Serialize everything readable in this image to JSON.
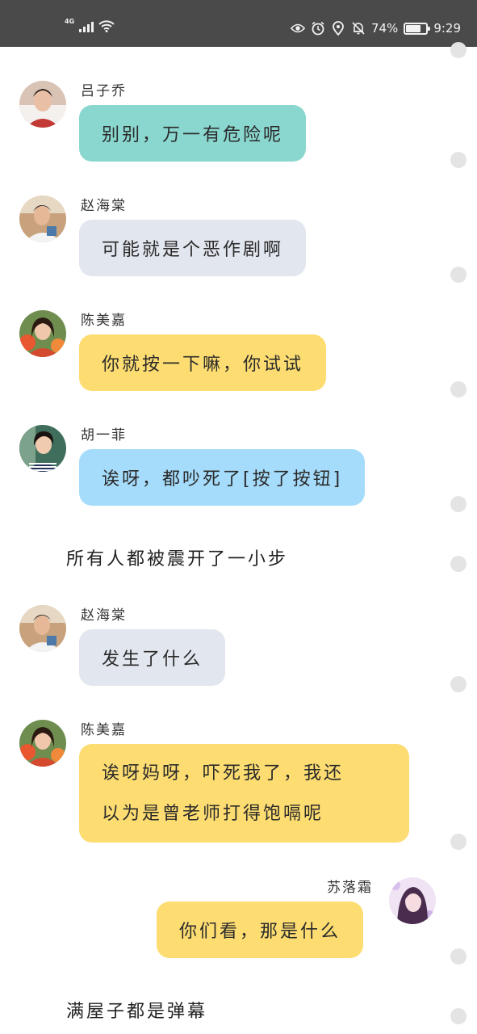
{
  "status_bar": {
    "network": "4G",
    "battery": "74%",
    "battery_level": 0.74,
    "time": "9:29",
    "icons": [
      "signal-icon",
      "wifi-icon",
      "eye-icon",
      "alarm-icon",
      "location-icon",
      "mute-bell-icon",
      "battery-icon"
    ]
  },
  "colors": {
    "teal": "#8ad7cf",
    "gray": "#e2e6ee",
    "yellow": "#fddd72",
    "blue": "#a6dcfb"
  },
  "messages": [
    {
      "type": "chat",
      "side": "left",
      "name": "吕子乔",
      "avatar": "avatar-lv",
      "color": "#8ad7cf",
      "text": "别别，万一有危险呢"
    },
    {
      "type": "chat",
      "side": "left",
      "name": "赵海棠",
      "avatar": "avatar-zhao",
      "color": "#e2e6ee",
      "text": "可能就是个恶作剧啊"
    },
    {
      "type": "chat",
      "side": "left",
      "name": "陈美嘉",
      "avatar": "avatar-chen",
      "color": "#fddd72",
      "text": "你就按一下嘛，你试试"
    },
    {
      "type": "chat",
      "side": "left",
      "name": "胡一菲",
      "avatar": "avatar-hu",
      "color": "#a6dcfb",
      "text": "诶呀，都吵死了[按了按钮]"
    },
    {
      "type": "narration",
      "text": "所有人都被震开了一小步"
    },
    {
      "type": "chat",
      "side": "left",
      "name": "赵海棠",
      "avatar": "avatar-zhao",
      "color": "#e2e6ee",
      "text": "发生了什么"
    },
    {
      "type": "chat",
      "side": "left",
      "name": "陈美嘉",
      "avatar": "avatar-chen",
      "color": "#fddd72",
      "lines": [
        "诶呀妈呀，吓死我了，我还",
        "以为是曾老师打得饱嗝呢"
      ]
    },
    {
      "type": "chat",
      "side": "right",
      "name": "苏落霜",
      "avatar": "avatar-su",
      "color": "#fddd72",
      "text": "你们看，那是什么"
    },
    {
      "type": "narration",
      "text": "满屋子都是弹幕"
    }
  ]
}
